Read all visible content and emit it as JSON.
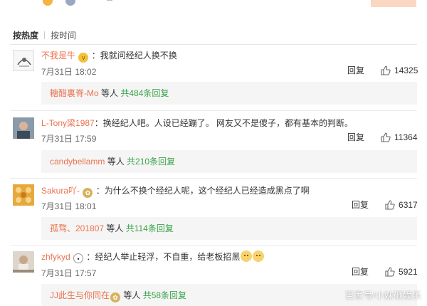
{
  "sort_tabs": {
    "hot": "按热度",
    "time": "按时间"
  },
  "comments": [
    {
      "user": "不我是牛",
      "text": "：我就问经纪人换不换",
      "time": "7月31日 18:02",
      "reply_label": "回复",
      "likes": "14325",
      "sub": {
        "name": "糖醋裏脊-Mo",
        "middle": " 等人 ",
        "count": "共484条回复"
      }
    },
    {
      "user": "L-Tony梁1987",
      "text": "：换经纪人吧。人设已经蹦了。 网友又不是傻子，都有基本的判断。",
      "time": "7月31日 17:59",
      "reply_label": "回复",
      "likes": "11364",
      "sub": {
        "name": "candybellamm",
        "middle": " 等人 ",
        "count": "共210条回复"
      }
    },
    {
      "user": "Sakura吖-",
      "text": "：为什么不换个经纪人呢，这个经纪人已经造成黑点了啊",
      "time": "7月31日 18:01",
      "reply_label": "回复",
      "likes": "6317",
      "sub": {
        "name": "孤骛、201807",
        "middle": " 等人 ",
        "count": "共114条回复"
      }
    },
    {
      "user": "zhfykyd",
      "text": "：经纪人举止轻浮，不自重，给老板招黑",
      "time": "7月31日 17:57",
      "reply_label": "回复",
      "likes": "5921",
      "sub": {
        "name": "JJ此生与你同在",
        "middle": " 等人 ",
        "count": "共58条回复"
      }
    }
  ],
  "watermark": "百家号/小妹砸娱乐",
  "colors": {
    "username": "#eb7350",
    "reply_count": "#3aa54a",
    "sub_bg": "#f5f5f5"
  }
}
